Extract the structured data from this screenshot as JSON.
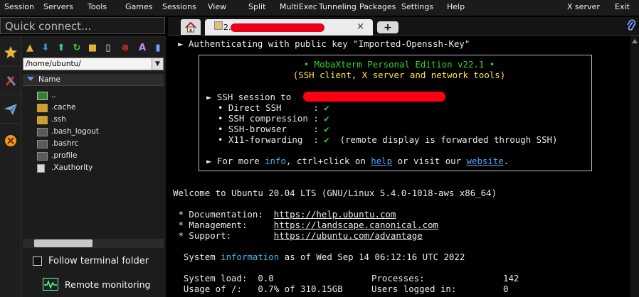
{
  "menubar": {
    "items": [
      "Session",
      "Servers",
      "Tools",
      "Games",
      "Sessions",
      "View",
      "Split",
      "MultiExec",
      "Tunneling",
      "Packages",
      "Settings",
      "Help",
      "X server",
      "Exit"
    ]
  },
  "quick_connect": {
    "placeholder": "Quick connect..."
  },
  "tabs": {
    "session_label": "2.",
    "close_glyph": "×",
    "new_tab_glyph": "+"
  },
  "sftp": {
    "path": "/home/ubuntu/",
    "column_header": "Name",
    "files": [
      {
        "name": "..",
        "type": "up"
      },
      {
        "name": ".cache",
        "type": "folder"
      },
      {
        "name": ".ssh",
        "type": "folder"
      },
      {
        "name": ".bash_logout",
        "type": "file"
      },
      {
        "name": ".bashrc",
        "type": "file"
      },
      {
        "name": ".profile",
        "type": "file"
      },
      {
        "name": ".Xauthority",
        "type": "doc"
      }
    ],
    "follow_label": "Follow terminal folder",
    "follow_checked": false,
    "remote_label": "Remote monitoring"
  },
  "terminal": {
    "auth_line": "Authenticating with public key \"Imported-Openssh-Key\"",
    "banner_title": "• MobaXterm Personal Edition v22.1 •",
    "banner_subtitle": "(SSH client, X server and network tools)",
    "ssh_session_label": "► SSH session to",
    "features": [
      {
        "label": "• Direct SSH      :",
        "status": "✔",
        "note": ""
      },
      {
        "label": "• SSH compression :",
        "status": "✔",
        "note": ""
      },
      {
        "label": "• SSH-browser     :",
        "status": "✔",
        "note": ""
      },
      {
        "label": "• X11-forwarding  :",
        "status": "✔",
        "note": "(remote display is forwarded through SSH)"
      }
    ],
    "more_prefix": "► For more ",
    "more_info": "info",
    "more_mid": ", ctrl+click on ",
    "more_help": "help",
    "more_mid2": " or visit our ",
    "more_website": "website",
    "more_end": ".",
    "welcome": "Welcome to Ubuntu 20.04 LTS (GNU/Linux 5.4.0-1018-aws x86_64)",
    "doc_label": " * Documentation:  ",
    "doc_url": "https://help.ubuntu.com",
    "mgmt_label": " * Management:     ",
    "mgmt_url": "https://landscape.canonical.com",
    "support_label": " * Support:        ",
    "support_url": "https://ubuntu.com/advantage",
    "sysinfo_prefix": "  System ",
    "sysinfo_word": "information",
    "sysinfo_suffix": " as of Wed Sep 14 06:12:16 UTC 2022",
    "load_label": "  System load:  ",
    "load_value": "0.0",
    "processes_label": "Processes:",
    "processes_value": "142",
    "usage_label": "  Usage of /:   ",
    "usage_value": "0.7% of 310.15GB",
    "users_label": "Users logged in:",
    "users_value": "0"
  },
  "colors": {
    "accent_green": "#2fd92f",
    "accent_yellow": "#ffe34a",
    "accent_cyan": "#3fb8e8",
    "redaction": "#ff0012"
  }
}
